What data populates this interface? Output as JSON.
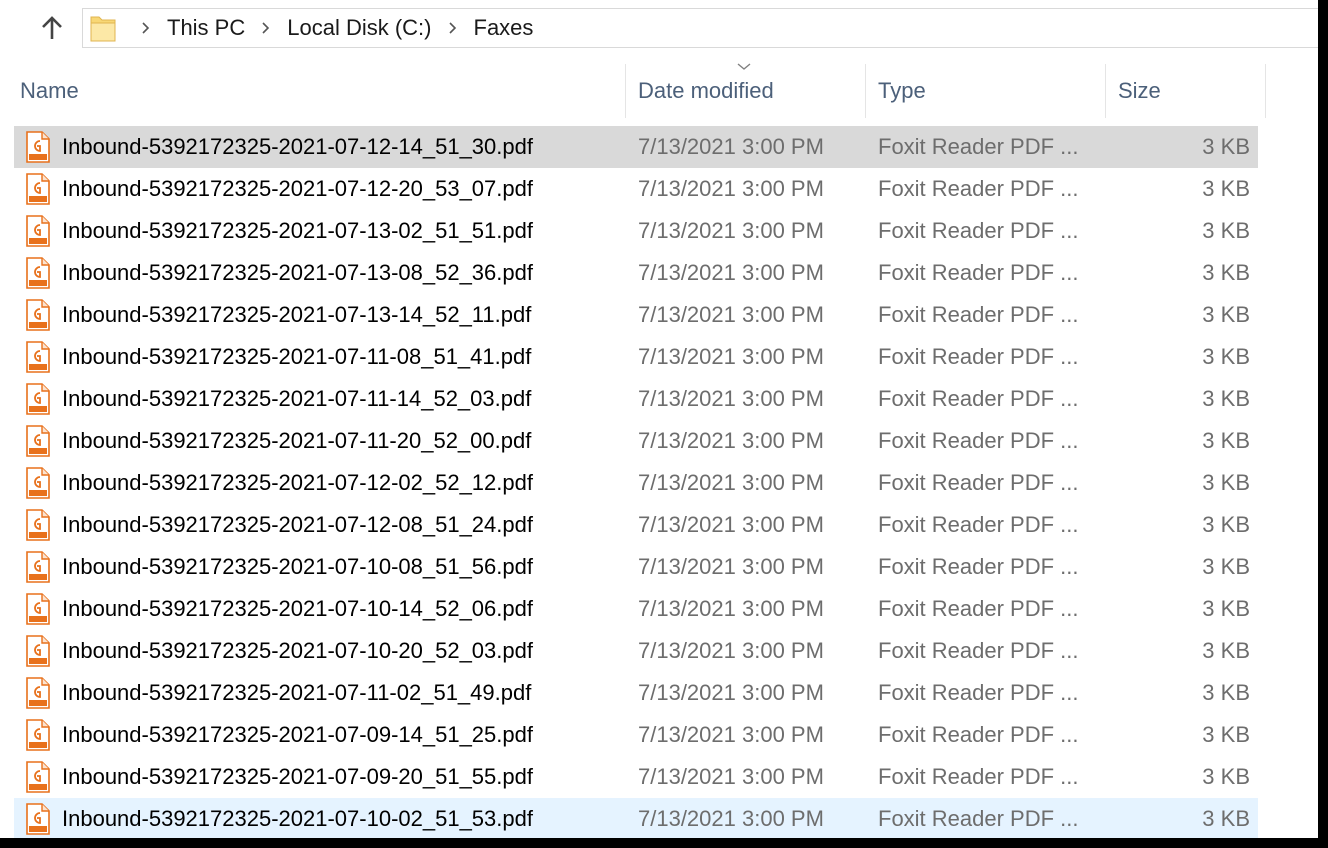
{
  "address": {
    "crumbs": [
      "This PC",
      "Local Disk (C:)",
      "Faxes"
    ]
  },
  "columns": {
    "name": "Name",
    "date": "Date modified",
    "type": "Type",
    "size": "Size"
  },
  "files": [
    {
      "name": "Inbound-5392172325-2021-07-12-14_51_30.pdf",
      "date": "7/13/2021 3:00 PM",
      "type": "Foxit Reader PDF ...",
      "size": "3 KB"
    },
    {
      "name": "Inbound-5392172325-2021-07-12-20_53_07.pdf",
      "date": "7/13/2021 3:00 PM",
      "type": "Foxit Reader PDF ...",
      "size": "3 KB"
    },
    {
      "name": "Inbound-5392172325-2021-07-13-02_51_51.pdf",
      "date": "7/13/2021 3:00 PM",
      "type": "Foxit Reader PDF ...",
      "size": "3 KB"
    },
    {
      "name": "Inbound-5392172325-2021-07-13-08_52_36.pdf",
      "date": "7/13/2021 3:00 PM",
      "type": "Foxit Reader PDF ...",
      "size": "3 KB"
    },
    {
      "name": "Inbound-5392172325-2021-07-13-14_52_11.pdf",
      "date": "7/13/2021 3:00 PM",
      "type": "Foxit Reader PDF ...",
      "size": "3 KB"
    },
    {
      "name": "Inbound-5392172325-2021-07-11-08_51_41.pdf",
      "date": "7/13/2021 3:00 PM",
      "type": "Foxit Reader PDF ...",
      "size": "3 KB"
    },
    {
      "name": "Inbound-5392172325-2021-07-11-14_52_03.pdf",
      "date": "7/13/2021 3:00 PM",
      "type": "Foxit Reader PDF ...",
      "size": "3 KB"
    },
    {
      "name": "Inbound-5392172325-2021-07-11-20_52_00.pdf",
      "date": "7/13/2021 3:00 PM",
      "type": "Foxit Reader PDF ...",
      "size": "3 KB"
    },
    {
      "name": "Inbound-5392172325-2021-07-12-02_52_12.pdf",
      "date": "7/13/2021 3:00 PM",
      "type": "Foxit Reader PDF ...",
      "size": "3 KB"
    },
    {
      "name": "Inbound-5392172325-2021-07-12-08_51_24.pdf",
      "date": "7/13/2021 3:00 PM",
      "type": "Foxit Reader PDF ...",
      "size": "3 KB"
    },
    {
      "name": "Inbound-5392172325-2021-07-10-08_51_56.pdf",
      "date": "7/13/2021 3:00 PM",
      "type": "Foxit Reader PDF ...",
      "size": "3 KB"
    },
    {
      "name": "Inbound-5392172325-2021-07-10-14_52_06.pdf",
      "date": "7/13/2021 3:00 PM",
      "type": "Foxit Reader PDF ...",
      "size": "3 KB"
    },
    {
      "name": "Inbound-5392172325-2021-07-10-20_52_03.pdf",
      "date": "7/13/2021 3:00 PM",
      "type": "Foxit Reader PDF ...",
      "size": "3 KB"
    },
    {
      "name": "Inbound-5392172325-2021-07-11-02_51_49.pdf",
      "date": "7/13/2021 3:00 PM",
      "type": "Foxit Reader PDF ...",
      "size": "3 KB"
    },
    {
      "name": "Inbound-5392172325-2021-07-09-14_51_25.pdf",
      "date": "7/13/2021 3:00 PM",
      "type": "Foxit Reader PDF ...",
      "size": "3 KB"
    },
    {
      "name": "Inbound-5392172325-2021-07-09-20_51_55.pdf",
      "date": "7/13/2021 3:00 PM",
      "type": "Foxit Reader PDF ...",
      "size": "3 KB"
    },
    {
      "name": "Inbound-5392172325-2021-07-10-02_51_53.pdf",
      "date": "7/13/2021 3:00 PM",
      "type": "Foxit Reader PDF ...",
      "size": "3 KB"
    }
  ],
  "selected_index": 0,
  "hover_index": 16,
  "icons": {
    "up": "arrow-up-icon",
    "folder": "folder-icon",
    "separator": "chevron-right-icon",
    "file": "pdf-file-icon",
    "sort": "sort-down-icon"
  },
  "colors": {
    "selected_row": "#d9d9d9",
    "hover_row": "#e5f3ff",
    "header_text": "#4c607a",
    "pdf_icon": "#e8711c"
  }
}
